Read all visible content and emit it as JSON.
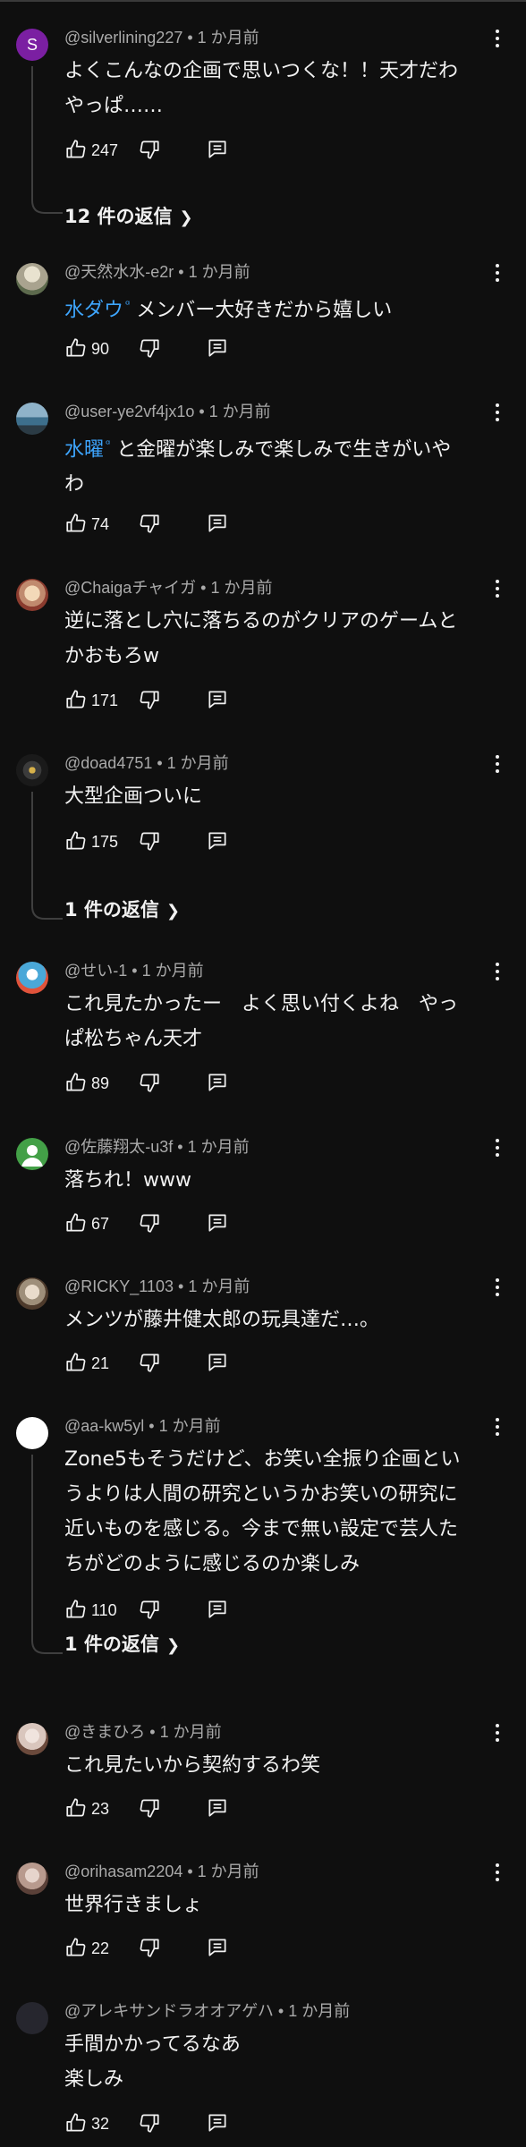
{
  "comments": [
    {
      "author": "@silverlining227",
      "time": "1 か月前",
      "lines": [
        "よくこんなの企画で思いつくな！！天才だわ",
        "やっぱ……"
      ],
      "likes": "247",
      "replies": "12 件の返信",
      "avatar_letter": "S",
      "avatar_color": "#7b1fa2"
    },
    {
      "author": "@天然水水-e2r",
      "time": "1 か月前",
      "mention": "水ダウ",
      "lines": [
        "メンバー大好きだから嬉しい"
      ],
      "likes": "90",
      "avatar_color": "#a9a38f"
    },
    {
      "author": "@user-ye2vf4jx1o",
      "time": "1 か月前",
      "mention": "水曜",
      "lines": [
        "と金曜が楽しみで楽しみで生きがいや",
        "わ"
      ],
      "likes": "74",
      "avatar_color": "#3d6f8c"
    },
    {
      "author": "@Chaigaチャイガ",
      "time": "1 か月前",
      "lines": [
        "逆に落とし穴に落ちるのがクリアのゲームと",
        "かおもろw"
      ],
      "likes": "171",
      "avatar_color": "#c08a6e"
    },
    {
      "author": "@doad4751",
      "time": "1 か月前",
      "lines": [
        "大型企画ついに"
      ],
      "likes": "175",
      "replies": "1 件の返信",
      "avatar_color": "#3b3b3b"
    },
    {
      "author": "@せい-1",
      "time": "1 か月前",
      "lines": [
        "これ見たかったー　よく思い付くよね　やっ",
        "ぱ松ちゃん天才"
      ],
      "likes": "89",
      "avatar_color": "#4aa8d8"
    },
    {
      "author": "@佐藤翔太-u3f",
      "time": "1 か月前",
      "lines": [
        "落ちれ！www"
      ],
      "likes": "67",
      "avatar_color": "#43a047"
    },
    {
      "author": "@RICKY_1103",
      "time": "1 か月前",
      "lines": [
        "メンツが藤井健太郎の玩具達だ…。"
      ],
      "likes": "21",
      "avatar_color": "#9e8f7a"
    },
    {
      "author": "@aa-kw5yl",
      "time": "1 か月前",
      "lines": [
        "Zone5もそうだけど、お笑い全振り企画とい",
        "うよりは人間の研究というかお笑いの研究に",
        "近いものを感じる。今まで無い設定で芸人た",
        "ちがどのように感じるのか楽しみ"
      ],
      "likes": "110",
      "replies": "1 件の返信",
      "avatar_color": "#ffffff"
    },
    {
      "author": "@きまひろ",
      "time": "1 か月前",
      "lines": [
        "これ見たいから契約するわ笑"
      ],
      "likes": "23",
      "avatar_color": "#d9c6bd"
    },
    {
      "author": "@orihasam2204",
      "time": "1 か月前",
      "lines": [
        "世界行きましょ"
      ],
      "likes": "22",
      "avatar_color": "#b89a8e"
    },
    {
      "author": "@アレキサンドラオオアゲハ",
      "time": "1 か月前",
      "lines": [
        "手間かかってるなあ",
        "楽しみ"
      ],
      "likes": "32",
      "avatar_color": "#26262e"
    }
  ]
}
